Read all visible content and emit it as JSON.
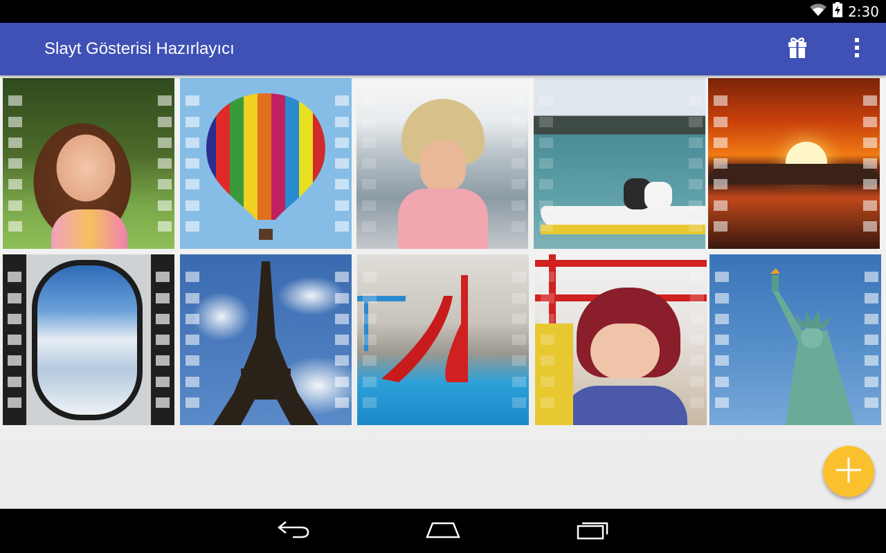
{
  "status_bar": {
    "time": "2:30",
    "wifi_icon": "wifi-icon",
    "battery_icon": "battery-charging-icon"
  },
  "app_bar": {
    "title": "Slayt Gösterisi Hazırlayıcı",
    "actions": [
      "gift-icon",
      "overflow-menu-icon"
    ]
  },
  "gallery": {
    "items": [
      {
        "name": "girl-smiling",
        "film": "light"
      },
      {
        "name": "hot-air-balloon",
        "film": "light"
      },
      {
        "name": "girl-sun-hat",
        "film": "light"
      },
      {
        "name": "pedal-boat",
        "film": "light"
      },
      {
        "name": "sunset",
        "film": "light"
      },
      {
        "name": "airplane-window",
        "film": "dark"
      },
      {
        "name": "eiffel-tower",
        "film": "light"
      },
      {
        "name": "water-slide",
        "film": "light"
      },
      {
        "name": "girl-helmet",
        "film": "light"
      },
      {
        "name": "statue-of-liberty",
        "film": "light"
      }
    ]
  },
  "fab": {
    "icon": "plus-icon",
    "color": "#fbc02d"
  },
  "nav_bar": {
    "buttons": [
      "back-icon",
      "home-icon",
      "recents-icon"
    ]
  },
  "colors": {
    "primary": "#3f51b5",
    "accent": "#fbc02d"
  }
}
